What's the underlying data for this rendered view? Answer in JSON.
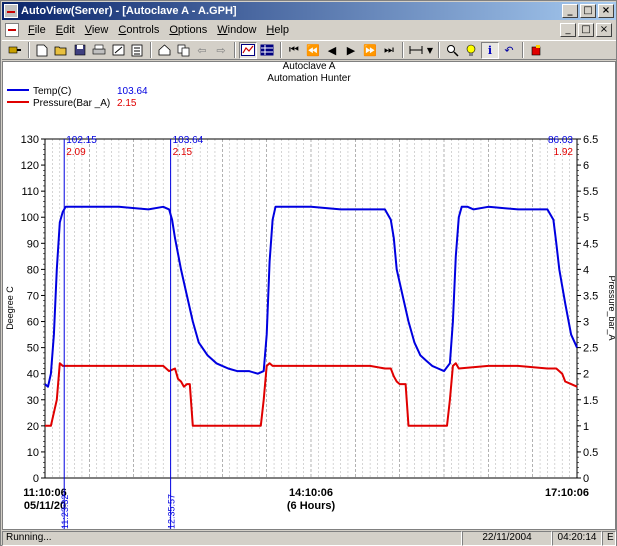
{
  "window": {
    "title": "AutoView(Server) - [Autoclave A - A.GPH]"
  },
  "menu": [
    {
      "label": "File",
      "key": "F"
    },
    {
      "label": "Edit",
      "key": "E"
    },
    {
      "label": "View",
      "key": "V"
    },
    {
      "label": "Controls",
      "key": "C"
    },
    {
      "label": "Options",
      "key": "O"
    },
    {
      "label": "Window",
      "key": "W"
    },
    {
      "label": "Help",
      "key": "H"
    }
  ],
  "chart_data": {
    "type": "line",
    "title": "Autoclave A",
    "subtitle": "Automation Hunter",
    "ylabel": "Deegree C",
    "y2label": "Pressure_bar_A",
    "ylim": [
      0,
      130
    ],
    "y2lim": [
      0,
      6.5
    ],
    "yticks": [
      "0",
      "10",
      "20",
      "30",
      "40",
      "50",
      "60",
      "70",
      "80",
      "90",
      "100",
      "110",
      "120",
      "130"
    ],
    "y2ticks": [
      "0",
      "0.5",
      "1",
      "1.5",
      "2",
      "2.5",
      "3",
      "3.5",
      "4",
      "4.5",
      "5",
      "5.5",
      "6",
      "6.5"
    ],
    "xlim_min": [
      0,
      360
    ],
    "x_labels": {
      "start_time": "11:10:06",
      "start_date": "05/11/20",
      "mid_time": "14:10:06",
      "mid_span": "(6 Hours)",
      "end_time": "17:10:06"
    },
    "legend": [
      {
        "name": "Temp(C)",
        "value": "103.64",
        "color": "#0000e0"
      },
      {
        "name": "Pressure(Bar _A)",
        "value": "2.15",
        "color": "#e00000"
      }
    ],
    "cursors": [
      {
        "x": 13,
        "label": "11:23:32",
        "temp": "102.15",
        "pressure": "2.09"
      },
      {
        "x": 85,
        "label": "12:35:57",
        "temp": "103.64",
        "pressure": "2.15"
      }
    ],
    "end_readout": {
      "temp": "86.03",
      "pressure": "1.92"
    },
    "series": [
      {
        "name": "Temp(C)",
        "color": "#0000e0",
        "axis": "left",
        "x": [
          0,
          2,
          4,
          6,
          8,
          10,
          12,
          14,
          16,
          20,
          30,
          50,
          70,
          80,
          84,
          86,
          88,
          92,
          96,
          100,
          104,
          110,
          116,
          120,
          124,
          130,
          138,
          144,
          148,
          150,
          152,
          154,
          156,
          158,
          160,
          168,
          180,
          200,
          220,
          230,
          234,
          236,
          238,
          242,
          246,
          250,
          254,
          258,
          262,
          266,
          270,
          274,
          276,
          278,
          280,
          282,
          286,
          290,
          300,
          320,
          340,
          344,
          346,
          348,
          352,
          356,
          360
        ],
        "values": [
          36,
          35,
          40,
          55,
          80,
          98,
          102,
          104,
          104,
          104,
          104,
          104,
          103,
          104,
          103,
          99,
          92,
          80,
          70,
          60,
          52,
          47,
          44,
          43,
          42,
          41,
          41,
          40,
          41,
          55,
          83,
          99,
          104,
          104,
          104,
          104,
          104,
          103,
          103,
          103,
          99,
          92,
          80,
          70,
          60,
          52,
          47,
          45,
          43,
          42,
          41,
          44,
          60,
          85,
          100,
          104,
          104,
          103,
          104,
          103,
          103,
          99,
          90,
          80,
          67,
          55,
          50
        ]
      },
      {
        "name": "Pressure(Bar _A)",
        "color": "#e00000",
        "axis": "right",
        "x": [
          0,
          4,
          8,
          10,
          12,
          20,
          40,
          60,
          80,
          84,
          88,
          90,
          92,
          94,
          96,
          98,
          100,
          110,
          120,
          138,
          146,
          148,
          150,
          152,
          154,
          160,
          180,
          200,
          220,
          230,
          234,
          236,
          238,
          240,
          242,
          244,
          246,
          256,
          268,
          272,
          274,
          276,
          278,
          280,
          300,
          320,
          340,
          346,
          350,
          352,
          356,
          360
        ],
        "values": [
          1.0,
          1.0,
          1.5,
          2.2,
          2.15,
          2.15,
          2.15,
          2.15,
          2.15,
          2.05,
          2.1,
          1.9,
          1.85,
          1.75,
          1.8,
          1.8,
          1.0,
          1.0,
          1.0,
          1.0,
          1.0,
          1.5,
          2.15,
          2.2,
          2.15,
          2.15,
          2.15,
          2.15,
          2.15,
          2.1,
          2.1,
          1.95,
          1.85,
          1.8,
          1.8,
          1.8,
          1.0,
          1.0,
          1.0,
          1.0,
          1.5,
          2.15,
          2.2,
          2.1,
          2.15,
          2.15,
          2.1,
          2.1,
          2.0,
          1.85,
          1.8,
          1.75
        ]
      }
    ]
  },
  "status": {
    "message": "Running...",
    "date": "22/11/2004",
    "time": "04:20:14",
    "mode": "E"
  }
}
